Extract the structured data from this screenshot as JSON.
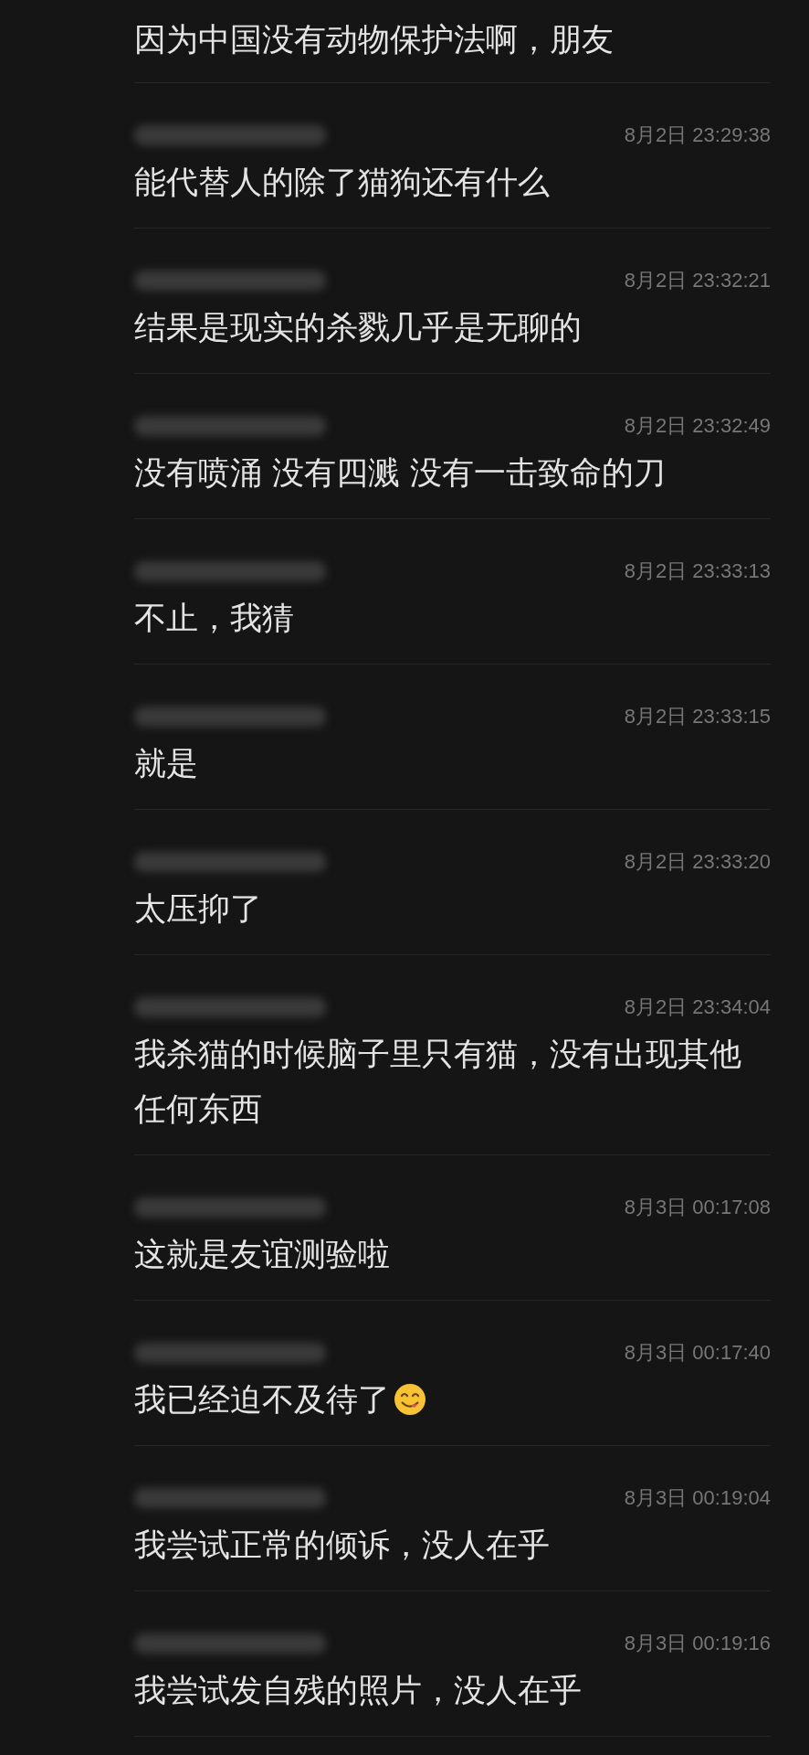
{
  "messages": [
    {
      "text": "因为中国没有动物保护法啊，朋友"
    },
    {
      "author": {
        "kind": "blurred"
      },
      "time": "8月2日 23:29:38",
      "text": "能代替人的除了猫狗还有什么"
    },
    {
      "author": {
        "kind": "blurred"
      },
      "time": "8月2日 23:32:21",
      "text": "结果是现实的杀戮几乎是无聊的"
    },
    {
      "author": {
        "kind": "blurred"
      },
      "time": "8月2日 23:32:49",
      "text": "没有喷涌 没有四溅 没有一击致命的刀"
    },
    {
      "author": {
        "kind": "blurred"
      },
      "time": "8月2日 23:33:13",
      "text": "不止，我猜"
    },
    {
      "author": {
        "kind": "blurred"
      },
      "time": "8月2日 23:33:15",
      "text": "就是"
    },
    {
      "author": {
        "kind": "blurred"
      },
      "time": "8月2日 23:33:20",
      "text": "太压抑了"
    },
    {
      "author": {
        "kind": "blurred"
      },
      "time": "8月2日 23:34:04",
      "text": "我杀猫的时候脑子里只有猫，没有出现其他任何东西"
    },
    {
      "author": {
        "kind": "blurred"
      },
      "time": "8月3日 00:17:08",
      "text": "这就是友谊测验啦"
    },
    {
      "author": {
        "kind": "blurred"
      },
      "time": "8月3日 00:17:40",
      "text": "我已经迫不及待了",
      "kind": "with_emoji"
    },
    {
      "author": {
        "kind": "blurred"
      },
      "time": "8月3日 00:19:04",
      "text": "我尝试正常的倾诉，没人在乎"
    },
    {
      "author": {
        "kind": "blurred"
      },
      "time": "8月3日 00:19:16",
      "text": "我尝试发自残的照片，没人在乎"
    }
  ]
}
